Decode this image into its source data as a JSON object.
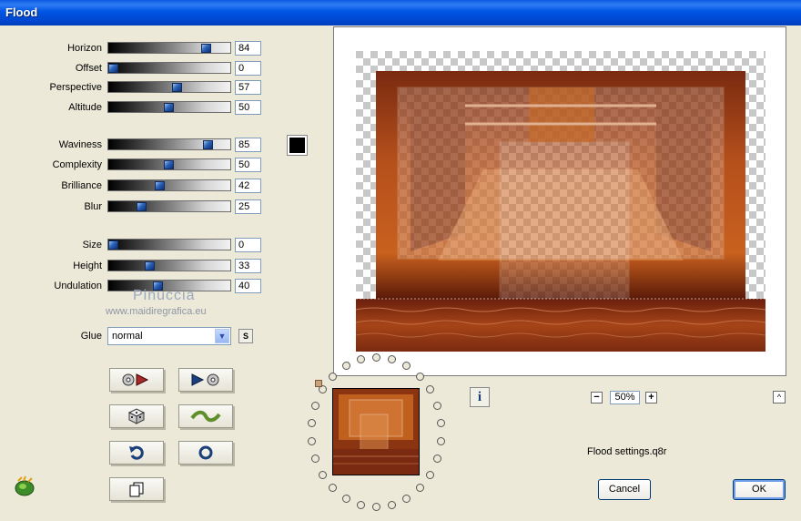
{
  "window": {
    "title": "Flood"
  },
  "sliders": [
    {
      "label": "Horizon",
      "value": "84",
      "fraction": 0.84
    },
    {
      "label": "Offset",
      "value": "0",
      "fraction": 0.0
    },
    {
      "label": "Perspective",
      "value": "57",
      "fraction": 0.57
    },
    {
      "label": "Altitude",
      "value": "50",
      "fraction": 0.5
    },
    {
      "label": "Waviness",
      "value": "85",
      "fraction": 0.85
    },
    {
      "label": "Complexity",
      "value": "50",
      "fraction": 0.5
    },
    {
      "label": "Brilliance",
      "value": "42",
      "fraction": 0.42
    },
    {
      "label": "Blur",
      "value": "25",
      "fraction": 0.25
    },
    {
      "label": "Size",
      "value": "0",
      "fraction": 0.0
    },
    {
      "label": "Height",
      "value": "33",
      "fraction": 0.33
    },
    {
      "label": "Undulation",
      "value": "40",
      "fraction": 0.4
    }
  ],
  "color_swatch": {
    "color": "#000000"
  },
  "watermark": {
    "line1": "Pinuccia",
    "line2": "www.maidiregrafica.eu"
  },
  "glue": {
    "label": "Glue",
    "selected": "normal",
    "s_button": "S"
  },
  "zoom": {
    "minus": "−",
    "value": "50%",
    "plus": "+",
    "collapse": "^"
  },
  "info": {
    "label": "i"
  },
  "settings_file": "Flood settings.q8r",
  "buttons": {
    "cancel": "Cancel",
    "ok": "OK"
  },
  "colors": {
    "title_blue": "#0055e5",
    "dialog_bg": "#ece9d8",
    "thumb_blue": "#2a62b8"
  }
}
